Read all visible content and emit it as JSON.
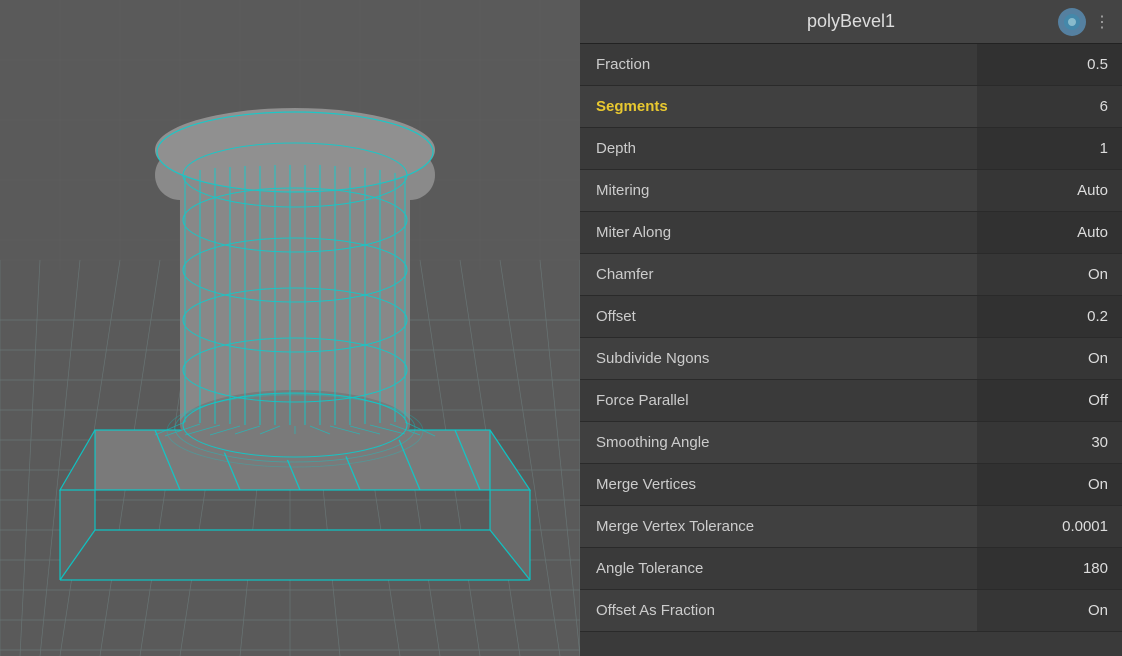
{
  "panel": {
    "title": "polyBevel1",
    "properties": [
      {
        "label": "Fraction",
        "value": "0.5",
        "highlight": false
      },
      {
        "label": "Segments",
        "value": "6",
        "highlight": true
      },
      {
        "label": "Depth",
        "value": "1",
        "highlight": false
      },
      {
        "label": "Mitering",
        "value": "Auto",
        "highlight": false
      },
      {
        "label": "Miter Along",
        "value": "Auto",
        "highlight": false
      },
      {
        "label": "Chamfer",
        "value": "On",
        "highlight": false
      },
      {
        "label": "Offset",
        "value": "0.2",
        "highlight": false
      },
      {
        "label": "Subdivide Ngons",
        "value": "On",
        "highlight": false
      },
      {
        "label": "Force Parallel",
        "value": "Off",
        "highlight": false
      },
      {
        "label": "Smoothing Angle",
        "value": "30",
        "highlight": false
      },
      {
        "label": "Merge Vertices",
        "value": "On",
        "highlight": false
      },
      {
        "label": "Merge Vertex Tolerance",
        "value": "0.0001",
        "highlight": false
      },
      {
        "label": "Angle Tolerance",
        "value": "180",
        "highlight": false
      },
      {
        "label": "Offset As Fraction",
        "value": "On",
        "highlight": false
      }
    ]
  },
  "viewport": {
    "bg_color": "#5a5a5a"
  }
}
